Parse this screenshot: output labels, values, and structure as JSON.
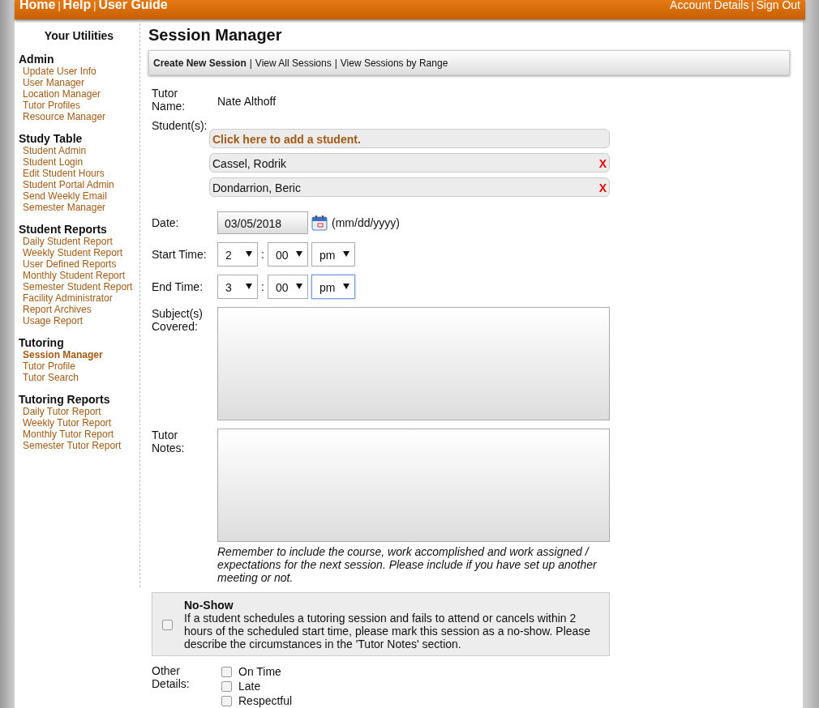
{
  "top_nav": {
    "separator": "|",
    "left": [
      {
        "label": "Home"
      },
      {
        "label": "Help"
      },
      {
        "label": "User Guide"
      }
    ],
    "right": [
      {
        "label": "Account Details"
      },
      {
        "label": "Sign Out"
      }
    ]
  },
  "sidebar": {
    "title": "Your Utilities",
    "sections": [
      {
        "heading": "Admin",
        "items": [
          {
            "label": "Update User Info",
            "selected": false
          },
          {
            "label": "User Manager",
            "selected": false
          },
          {
            "label": "Location Manager",
            "selected": false
          },
          {
            "label": "Tutor Profiles",
            "selected": false
          },
          {
            "label": "Resource Manager",
            "selected": false
          }
        ]
      },
      {
        "heading": "Study Table",
        "items": [
          {
            "label": "Student Admin",
            "selected": false
          },
          {
            "label": "Student Login",
            "selected": false
          },
          {
            "label": "Edit Student Hours",
            "selected": false
          },
          {
            "label": "Student Portal Admin",
            "selected": false
          },
          {
            "label": "Send Weekly Email",
            "selected": false
          },
          {
            "label": "Semester Manager",
            "selected": false
          }
        ]
      },
      {
        "heading": "Student Reports",
        "items": [
          {
            "label": "Daily Student Report",
            "selected": false
          },
          {
            "label": "Weekly Student Report",
            "selected": false
          },
          {
            "label": "User Defined Reports",
            "selected": false
          },
          {
            "label": "Monthly Student Report",
            "selected": false
          },
          {
            "label": "Semester Student Report",
            "selected": false
          },
          {
            "label": "Facility Administrator",
            "selected": false
          },
          {
            "label": "Report Archives",
            "selected": false
          },
          {
            "label": "Usage Report",
            "selected": false
          }
        ]
      },
      {
        "heading": "Tutoring",
        "items": [
          {
            "label": "Session Manager",
            "selected": true
          },
          {
            "label": "Tutor Profile",
            "selected": false
          },
          {
            "label": "Tutor Search",
            "selected": false
          }
        ]
      },
      {
        "heading": "Tutoring Reports",
        "items": [
          {
            "label": "Daily Tutor Report",
            "selected": false
          },
          {
            "label": "Weekly Tutor Report",
            "selected": false
          },
          {
            "label": "Monthly Tutor Report",
            "selected": false
          },
          {
            "label": "Semester Tutor Report",
            "selected": false
          }
        ]
      }
    ]
  },
  "main": {
    "title": "Session Manager",
    "subnav_separator": "|",
    "subnav": [
      {
        "label": "Create New Session",
        "selected": true
      },
      {
        "label": "View All Sessions",
        "selected": false
      },
      {
        "label": "View Sessions by Range",
        "selected": false
      }
    ],
    "tutor": {
      "label": "Tutor Name:",
      "value": "Nate Althoff"
    },
    "students": {
      "label": "Student(s):",
      "add_link": "Click here to add a student.",
      "list": [
        {
          "name": "Cassel, Rodrik",
          "remove": "X"
        },
        {
          "name": "Dondarrion, Beric",
          "remove": "X"
        }
      ]
    },
    "date": {
      "label": "Date:",
      "value": "03/05/2018",
      "format": "(mm/dd/yyyy)"
    },
    "times": [
      {
        "label": "Start Time:",
        "separator": ":",
        "selects": [
          {
            "value": "2",
            "focused": false
          },
          {
            "value": "00",
            "focused": false
          },
          {
            "value": "pm",
            "focused": false
          }
        ]
      },
      {
        "label": "End Time:",
        "separator": ":",
        "selects": [
          {
            "value": "3",
            "focused": false
          },
          {
            "value": "00",
            "focused": false
          },
          {
            "value": "pm",
            "focused": true
          }
        ]
      }
    ],
    "subjects": {
      "label": "Subject(s) Covered:"
    },
    "notes": {
      "label": "Tutor Notes:",
      "hint": "Remember to include the course, work accomplished and work assigned / expectations for the next session. Please include if you have set up another meeting or not."
    },
    "no_show": {
      "title": "No-Show",
      "text": "If a student schedules a tutoring session and fails to attend or cancels within 2 hours of the scheduled start time, please mark this session as a no-show. Please describe the circumstances in the 'Tutor Notes' section.",
      "checked": false
    },
    "other_details": {
      "label": "Other Details:",
      "options": [
        {
          "label": "On Time",
          "checked": false
        },
        {
          "label": "Late",
          "checked": false
        },
        {
          "label": "Respectful",
          "checked": false
        }
      ]
    }
  }
}
